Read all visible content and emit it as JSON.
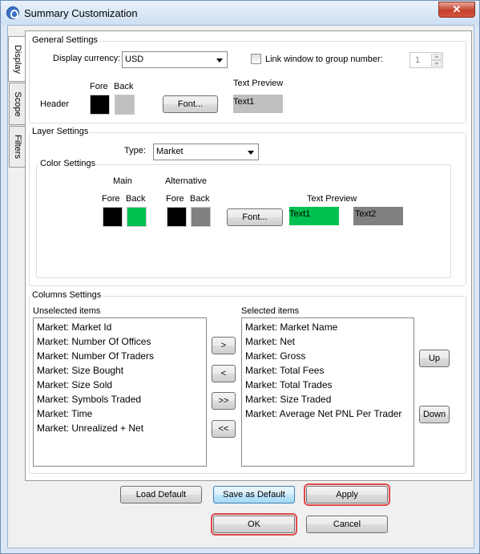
{
  "window": {
    "title": "Summary Customization",
    "close_glyph": "✕"
  },
  "tabs": [
    {
      "label": "Display",
      "active": true
    },
    {
      "label": "Scope",
      "active": false
    },
    {
      "label": "Filters",
      "active": false
    }
  ],
  "general": {
    "title": "General Settings",
    "currency_label": "Display currency:",
    "currency_value": "USD",
    "link_label": "Link window to group number:",
    "link_checked": false,
    "link_number": "1",
    "fore_label": "Fore",
    "back_label": "Back",
    "header_label": "Header",
    "font_button": "Font...",
    "text_preview_label": "Text Preview",
    "preview_text": "Text1",
    "fore_color": "#000000",
    "back_color": "#c0c0c0"
  },
  "layer": {
    "title": "Layer Settings",
    "type_label": "Type:",
    "type_value": "Market",
    "color_title": "Color Settings",
    "main_label": "Main",
    "alt_label": "Alternative",
    "fore_label": "Fore",
    "back_label": "Back",
    "font_button": "Font...",
    "text_preview_label": "Text Preview",
    "preview_text1": "Text1",
    "preview_text2": "Text2",
    "main_fore": "#000000",
    "main_back": "#00c050",
    "alt_fore": "#000000",
    "alt_back": "#808080"
  },
  "columns": {
    "title": "Columns Settings",
    "unselected_label": "Unselected items",
    "selected_label": "Selected items",
    "unselected": [
      "Market: Market Id",
      "Market: Number Of Offices",
      "Market: Number Of Traders",
      "Market: Size Bought",
      "Market: Size Sold",
      "Market: Symbols Traded",
      "Market: Time",
      "Market: Unrealized + Net"
    ],
    "selected": [
      "Market: Market Name",
      "Market: Net",
      "Market: Gross",
      "Market: Total Fees",
      "Market: Total Trades",
      "Market: Size Traded",
      "Market: Average Net PNL Per Trader"
    ],
    "move_right": ">",
    "move_left": "<",
    "move_all_right": ">>",
    "move_all_left": "<<",
    "up": "Up",
    "down": "Down"
  },
  "footer": {
    "load_default": "Load Default",
    "save_default": "Save as Default",
    "apply": "Apply",
    "ok": "OK",
    "cancel": "Cancel"
  }
}
